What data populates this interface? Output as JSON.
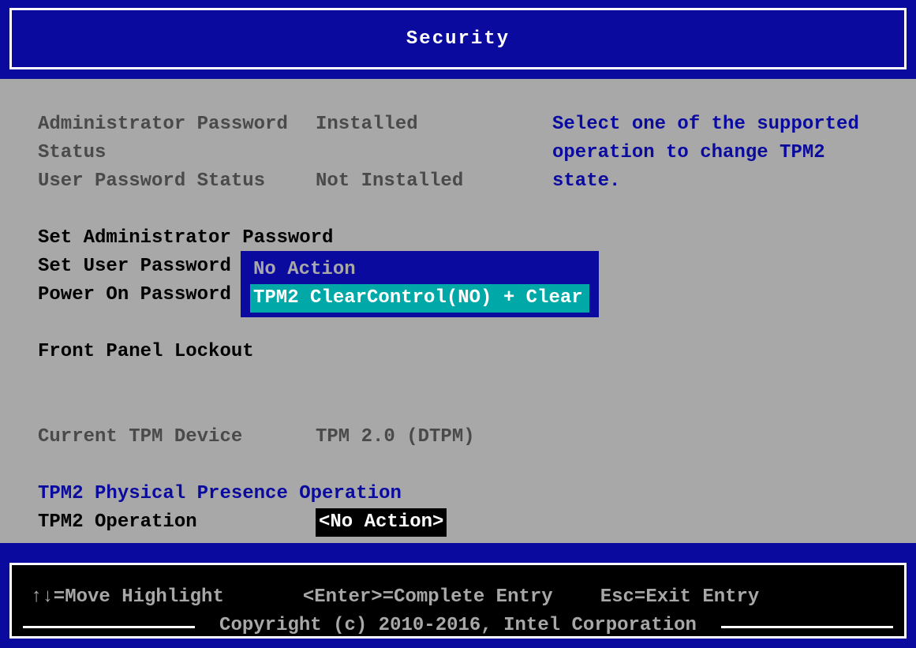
{
  "header": {
    "title": "Security"
  },
  "help": "Select one of the supported operation to change TPM2 state.",
  "status": {
    "admin_pw_label": "Administrator Password Status",
    "admin_pw_value": "Installed",
    "user_pw_label": "User Password Status",
    "user_pw_value": "Not Installed"
  },
  "menu": {
    "set_admin_pw": "Set Administrator Password",
    "set_user_pw": "Set User Password",
    "power_on_pw": "Power On Password",
    "front_panel_lockout": "Front Panel Lockout"
  },
  "tpm": {
    "current_device_label": "Current TPM Device",
    "current_device_value": "TPM 2.0 (DTPM)",
    "section_heading": "TPM2 Physical Presence Operation",
    "operation_label": "TPM2 Operation",
    "operation_value": "<No Action>"
  },
  "popup": {
    "options": [
      "No Action",
      "TPM2 ClearControl(NO) + Clear"
    ],
    "selected_index": 1
  },
  "footer": {
    "hint_move": "↑↓=Move Highlight",
    "hint_enter": "<Enter>=Complete Entry",
    "hint_esc": "Esc=Exit Entry",
    "copyright": "Copyright (c) 2010-2016, Intel Corporation"
  }
}
